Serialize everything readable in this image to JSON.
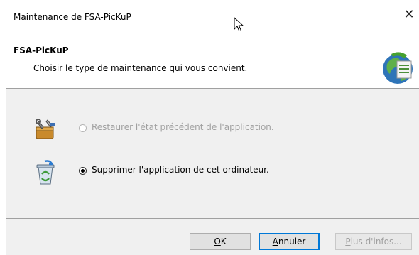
{
  "window": {
    "title": "Maintenance de FSA-PicKuP",
    "close_glyph": "✕"
  },
  "header": {
    "product_name": "FSA-PicKuP",
    "subtitle": "Choisir le type de maintenance qui vous convient."
  },
  "options": [
    {
      "label": "Restaurer l'état précédent de l'application.",
      "enabled": false,
      "selected": false,
      "icon": "repair-toolbox-icon"
    },
    {
      "label": "Supprimer l'application de cet ordinateur.",
      "enabled": true,
      "selected": true,
      "icon": "recycle-bin-icon"
    }
  ],
  "buttons": {
    "ok_accel": "O",
    "ok_rest": "K",
    "cancel_accel": "A",
    "cancel_rest": "nnuler",
    "more_accel": "P",
    "more_rest": "lus d'infos..."
  },
  "colors": {
    "accent": "#0078d7",
    "content_bg": "#f0f0f0",
    "disabled_text": "#a0a0a0"
  }
}
